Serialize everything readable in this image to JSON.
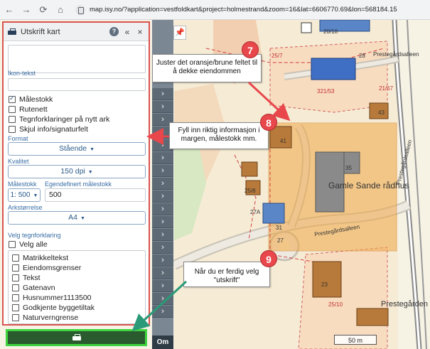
{
  "browser": {
    "url": "map.isy.no/?application=vestfoldkart&project=holmestrand&zoom=16&lat=6606770.69&lon=568184.15"
  },
  "panel": {
    "title": "Utskrift kart",
    "ikon_label": "Ikon-tekst",
    "checkboxes": [
      {
        "label": "Målestokk",
        "checked": true
      },
      {
        "label": "Rutenett",
        "checked": false
      },
      {
        "label": "Tegnforklaringer på nytt ark",
        "checked": false
      },
      {
        "label": "Skjul info/signaturfelt",
        "checked": false
      }
    ],
    "format_label": "Format",
    "format_value": "Stående",
    "quality_label": "Kvalitet",
    "quality_value": "150 dpi",
    "scale_label": "Målestokk",
    "custom_scale_label": "Egendefinert målestokk",
    "scale_value": "1: 500",
    "custom_scale_value": "500",
    "paper_label": "Arkstørrelse",
    "paper_value": "A4",
    "legend_label": "Velg tegnforklaring",
    "select_all": "Velg alle",
    "legend_items": [
      "Matrikkeltekst",
      "Eiendomsgrenser",
      "Tekst",
      "Gatenavn",
      "Husnummer1113500",
      "Godkjente byggetiltak",
      "Naturverngrense"
    ]
  },
  "strip": {
    "om_label": "Om"
  },
  "callouts": {
    "c7": {
      "badge": "7",
      "text": "Juster det oransje/brune feltet til å dekke eiendommen"
    },
    "c8": {
      "badge": "8",
      "text": "Fyll inn riktig informasjon i margen, målestokk mm."
    },
    "c9": {
      "badge": "9",
      "text": "Når du er ferdig velg \"utskrift\""
    }
  },
  "map": {
    "place_1": "Gamle Sande rådhus",
    "place_2": "Prestegården",
    "road_1": "Prestegårdsalleen",
    "road_2": "Prestegårdsalleen",
    "road_3": "Prestegårdsalleen",
    "labels": [
      "20/18",
      "28",
      "25/7",
      "321/53",
      "21/67",
      "43",
      "35",
      "41",
      "31",
      "27",
      "25/8",
      "27A",
      "23",
      "25/10"
    ],
    "scale_text": "50 m"
  },
  "colors": {
    "panel_border": "#d9534f",
    "print_button": "#2a5b2f",
    "print_button_border": "#3fd43f",
    "print_area": "#f0a848",
    "badge": "#e8474c"
  }
}
